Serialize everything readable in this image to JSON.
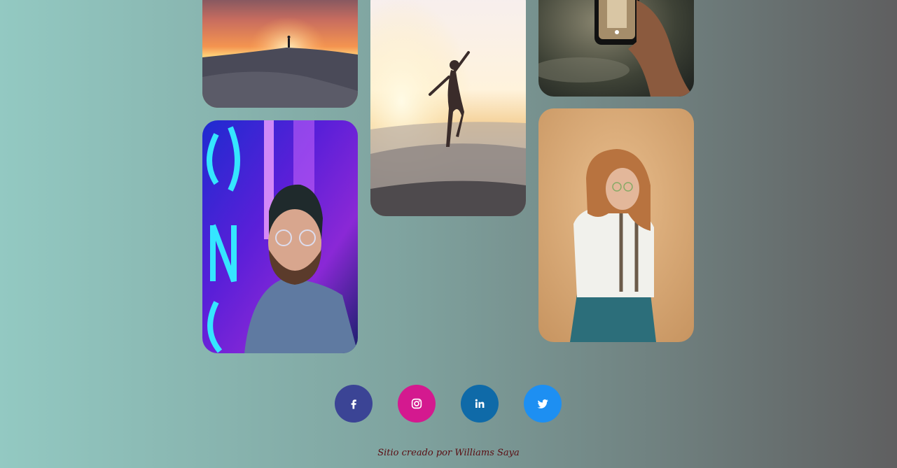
{
  "gallery": {
    "photos": [
      {
        "icon": "desert-sunset-photo"
      },
      {
        "icon": "dancer-desert-photo"
      },
      {
        "icon": "phone-in-hand-photo"
      },
      {
        "icon": "neon-portrait-photo"
      },
      {
        "icon": "woman-suspenders-photo"
      }
    ]
  },
  "social": {
    "facebook": {
      "icon": "facebook-icon",
      "color": "#3b4495"
    },
    "instagram": {
      "icon": "instagram-icon",
      "color": "#d4198f"
    },
    "linkedin": {
      "icon": "linkedin-icon",
      "color": "#0f6aa8"
    },
    "twitter": {
      "icon": "twitter-icon",
      "color": "#1d8ff2"
    }
  },
  "footer": {
    "credit": "Sitio creado por Williams Saya"
  }
}
